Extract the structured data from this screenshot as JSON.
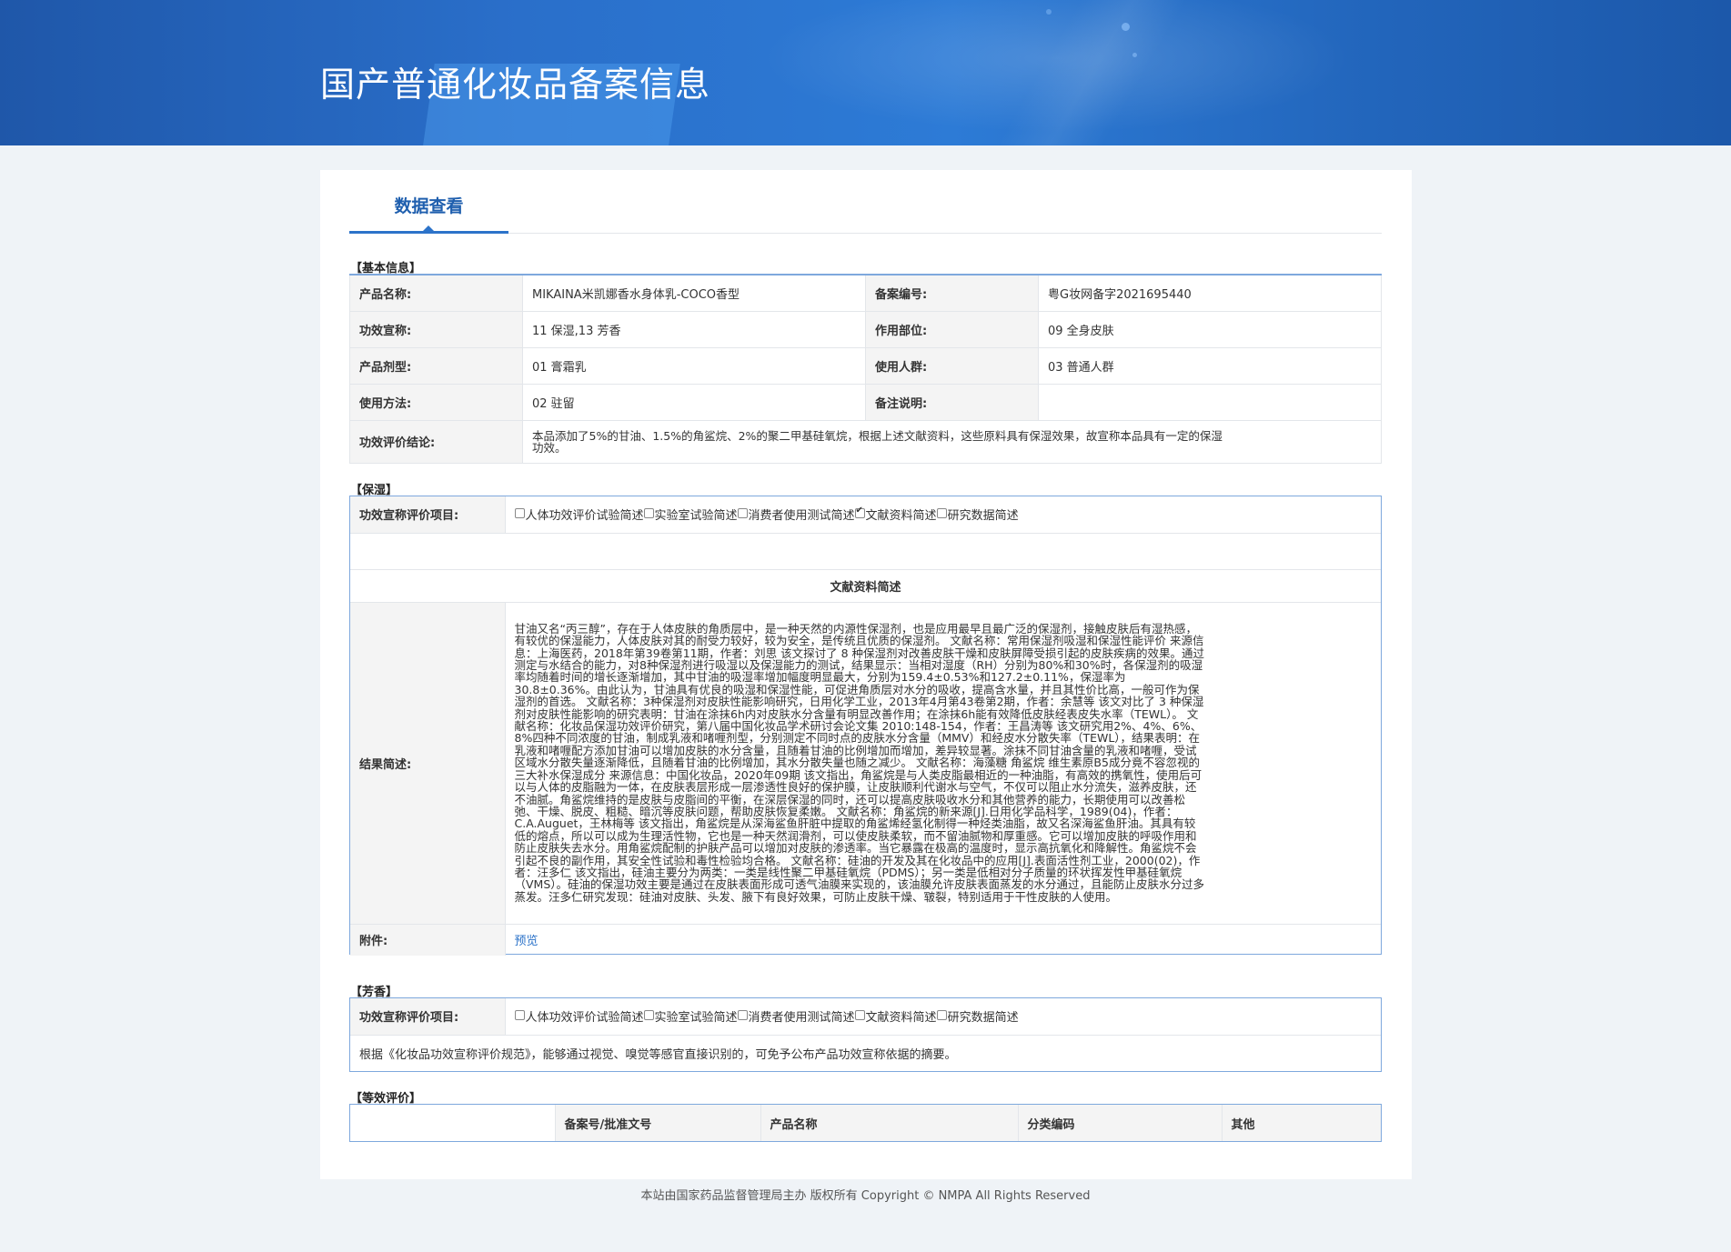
{
  "header": {
    "title": "国产普通化妆品备案信息"
  },
  "tabs": [
    {
      "label": "数据查看"
    }
  ],
  "basic": {
    "section_title": "【基本信息】",
    "rows": [
      {
        "label1": "产品名称:",
        "value1": "MIKAINA米凯娜香水身体乳-COCO香型",
        "label2": "备案编号:",
        "value2": "粤G妆网备字2021695440"
      },
      {
        "label1": "功效宣称:",
        "value1": "11 保湿,13 芳香",
        "label2": "作用部位:",
        "value2": "09 全身皮肤"
      },
      {
        "label1": "产品剂型:",
        "value1": "01 膏霜乳",
        "label2": "使用人群:",
        "value2": "03 普通人群"
      },
      {
        "label1": "使用方法:",
        "value1": "02 驻留",
        "label2": "备注说明:",
        "value2": ""
      }
    ],
    "conclusion_label": "功效评价结论:",
    "conclusion_value": "本品添加了5%的甘油、1.5%的角鲨烷、2%的聚二甲基硅氧烷，根据上述文献资料，这些原料具有保湿效果，故宣称本品具有一定的保湿功效。"
  },
  "moisture": {
    "section_title": "【保湿】",
    "items_label": "功效宣称评价项目:",
    "options": [
      {
        "label": "人体功效评价试验简述",
        "checked": false
      },
      {
        "label": "实验室试验简述",
        "checked": false
      },
      {
        "label": "消费者使用测试简述",
        "checked": false
      },
      {
        "label": "文献资料简述",
        "checked": true
      },
      {
        "label": "研究数据简述",
        "checked": false
      }
    ],
    "literature_heading": "文献资料简述",
    "result_label": "结果简述:",
    "result_text": "甘油又名“丙三醇”，存在于人体皮肤的角质层中，是一种天然的内源性保湿剂，也是应用最早且最广泛的保湿剂，接触皮肤后有湿热感，有较优的保湿能力，人体皮肤对其的耐受力较好，较为安全，是传统且优质的保湿剂。 文献名称：常用保湿剂吸湿和保湿性能评价 来源信息：上海医药，2018年第39卷第11期，作者：刘思 该文探讨了 8 种保湿剂对改善皮肤干燥和皮肤屏障受损引起的皮肤疾病的效果。通过测定与水结合的能力，对8种保湿剂进行吸湿以及保湿能力的测试，结果显示：当相对湿度（RH）分别为80%和30%时，各保湿剂的吸湿率均随着时间的增长逐渐增加，其中甘油的吸湿率增加幅度明显最大，分别为159.4±0.53%和127.2±0.11%，保湿率为30.8±0.36%。由此认为，甘油具有优良的吸湿和保湿性能，可促进角质层对水分的吸收，提高含水量，并且其性价比高，一般可作为保湿剂的首选。 文献名称：3种保湿剂对皮肤性能影响研究，日用化学工业，2013年4月第43卷第2期，作者：余慧等 该文对比了 3 种保湿剂对皮肤性能影响的研究表明：甘油在涂抹6h内对皮肤水分含量有明显改善作用；在涂抹6h能有效降低皮肤经表皮失水率（TEWL）。 文献名称：化妆品保湿功效评价研究，第八届中国化妆品学术研讨会论文集 2010:148-154，作者：王昌涛等 该文研究用2%、4%、6%、8%四种不同浓度的甘油，制成乳液和啫喱剂型，分别测定不同时点的皮肤水分含量（MMV）和经皮水分散失率（TEWL），结果表明：在乳液和啫喱配方添加甘油可以增加皮肤的水分含量，且随着甘油的比例增加而增加，差异较显著。涂抹不同甘油含量的乳液和啫喱，受试区域水分散失量逐渐降低，且随着甘油的比例增加，其水分散失量也随之减少。 文献名称：海藻糖 角鲨烷 维生素原B5成分竟不容忽视的三大补水保湿成分 来源信息：中国化妆品，2020年09期 该文指出，角鲨烷是与人类皮脂最相近的一种油脂，有高效的携氧性，使用后可以与人体的皮脂融为一体，在皮肤表层形成一层渗透性良好的保护膜，让皮肤顺利代谢水与空气，不仅可以阻止水分流失，滋养皮肤，还不油腻。角鲨烷维持的是皮肤与皮脂间的平衡，在深层保湿的同时，还可以提高皮肤吸收水分和其他营养的能力，长期使用可以改善松弛、干燥、脱皮、粗糙、暗沉等皮肤问题，帮助皮肤恢复柔嫩。 文献名称：角鲨烷的新来源[J].日用化学品科学，1989(04)，作者：C.A.Auguet，王林梅等 该文指出，角鲨烷是从深海鲨鱼肝脏中提取的角鲨烯经氢化制得一种烃类油脂，故又名深海鲨鱼肝油。其具有较低的熔点，所以可以成为生理活性物，它也是一种天然润滑剂，可以使皮肤柔软，而不留油腻物和厚重感。它可以增加皮肤的呼吸作用和防止皮肤失去水分。用角鲨烷配制的护肤产品可以增加对皮肤的渗透率。当它暴露在极高的温度时，显示高抗氧化和降解性。角鲨烷不会引起不良的副作用，其安全性试验和毒性检验均合格。 文献名称：硅油的开发及其在化妆品中的应用[J].表面活性剂工业，2000(02)，作者：汪多仁 该文指出，硅油主要分为两类：一类是线性聚二甲基硅氧烷（PDMS）；另一类是低相对分子质量的环状挥发性甲基硅氧烷（VMS）。硅油的保湿功效主要是通过在皮肤表面形成可透气油膜来实现的，该油膜允许皮肤表面蒸发的水分通过，且能防止皮肤水分过多蒸发。汪多仁研究发现：硅油对皮肤、头发、腋下有良好效果，可防止皮肤干燥、皲裂，特别适用于干性皮肤的人使用。",
    "attachment_label": "附件:",
    "attachment_link": "预览"
  },
  "fragrance": {
    "section_title": "【芳香】",
    "items_label": "功效宣称评价项目:",
    "options": [
      {
        "label": "人体功效评价试验简述",
        "checked": false
      },
      {
        "label": "实验室试验简述",
        "checked": false
      },
      {
        "label": "消费者使用测试简述",
        "checked": false
      },
      {
        "label": "文献资料简述",
        "checked": false
      },
      {
        "label": "研究数据简述",
        "checked": false
      }
    ],
    "note": "根据《化妆品功效宣称评价规范》，能够通过视觉、嗅觉等感官直接识别的，可免予公布产品功效宣称依据的摘要。"
  },
  "equivalence": {
    "section_title": "【等效评价】",
    "columns": [
      "",
      "备案号/批准文号",
      "产品名称",
      "分类编码",
      "其他"
    ]
  },
  "footer": {
    "text": "本站由国家药品监督管理局主办 版权所有 Copyright © NMPA All Rights Reserved"
  }
}
